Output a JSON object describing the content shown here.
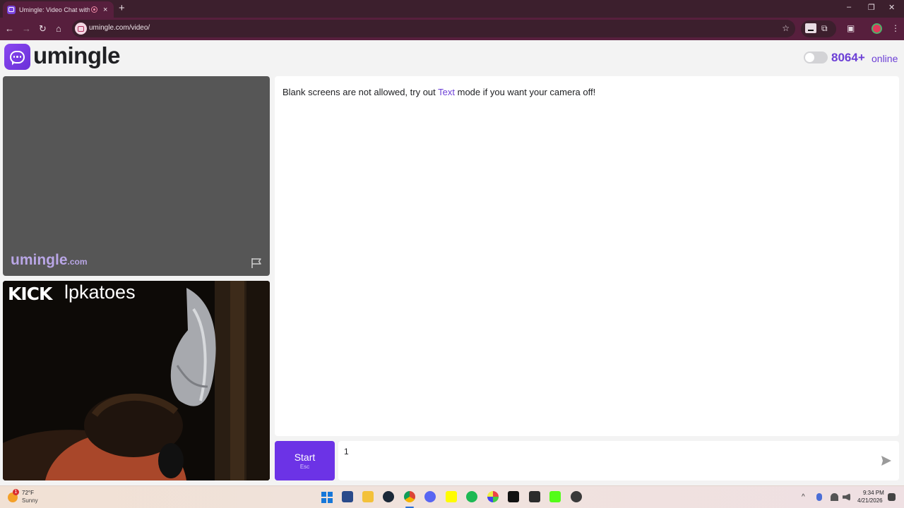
{
  "browser": {
    "tab_title": "Umingle: Video Chat with S",
    "tab_close": "×",
    "new_tab": "+",
    "url": "umingle.com/video/",
    "win_minimize": "–",
    "win_restore": "❐",
    "win_close": "✕",
    "nav_back": "←",
    "nav_forward": "→",
    "nav_reload": "↻",
    "nav_home": "⌂",
    "star": "☆",
    "ext2": "⧉",
    "split": "▣",
    "menu": "⋮"
  },
  "header": {
    "logo_text": "umingle",
    "online_count": "8064+",
    "online_label": "online"
  },
  "stranger_video": {
    "watermark": "umingle",
    "watermark_suffix": ".com"
  },
  "self_video": {
    "overlay_logo": "KICK",
    "overlay_user": "lpkatoes"
  },
  "chat": {
    "message_before": "Blank screens are not allowed, try out ",
    "message_link": "Text",
    "message_after": " mode if you want your camera off!",
    "start_label": "Start",
    "start_hint": "Esc",
    "input_value": "1"
  },
  "taskbar": {
    "weather_badge": "1",
    "weather_temp": "72°F",
    "weather_cond": "Sunny",
    "tray_chevron": "^",
    "time": "9:34 PM",
    "date": "4/21/2026"
  },
  "colors": {
    "brand": "#6c33e6",
    "browser_frame": "#3c1f2d",
    "browser_toolbar": "#571f3d"
  }
}
